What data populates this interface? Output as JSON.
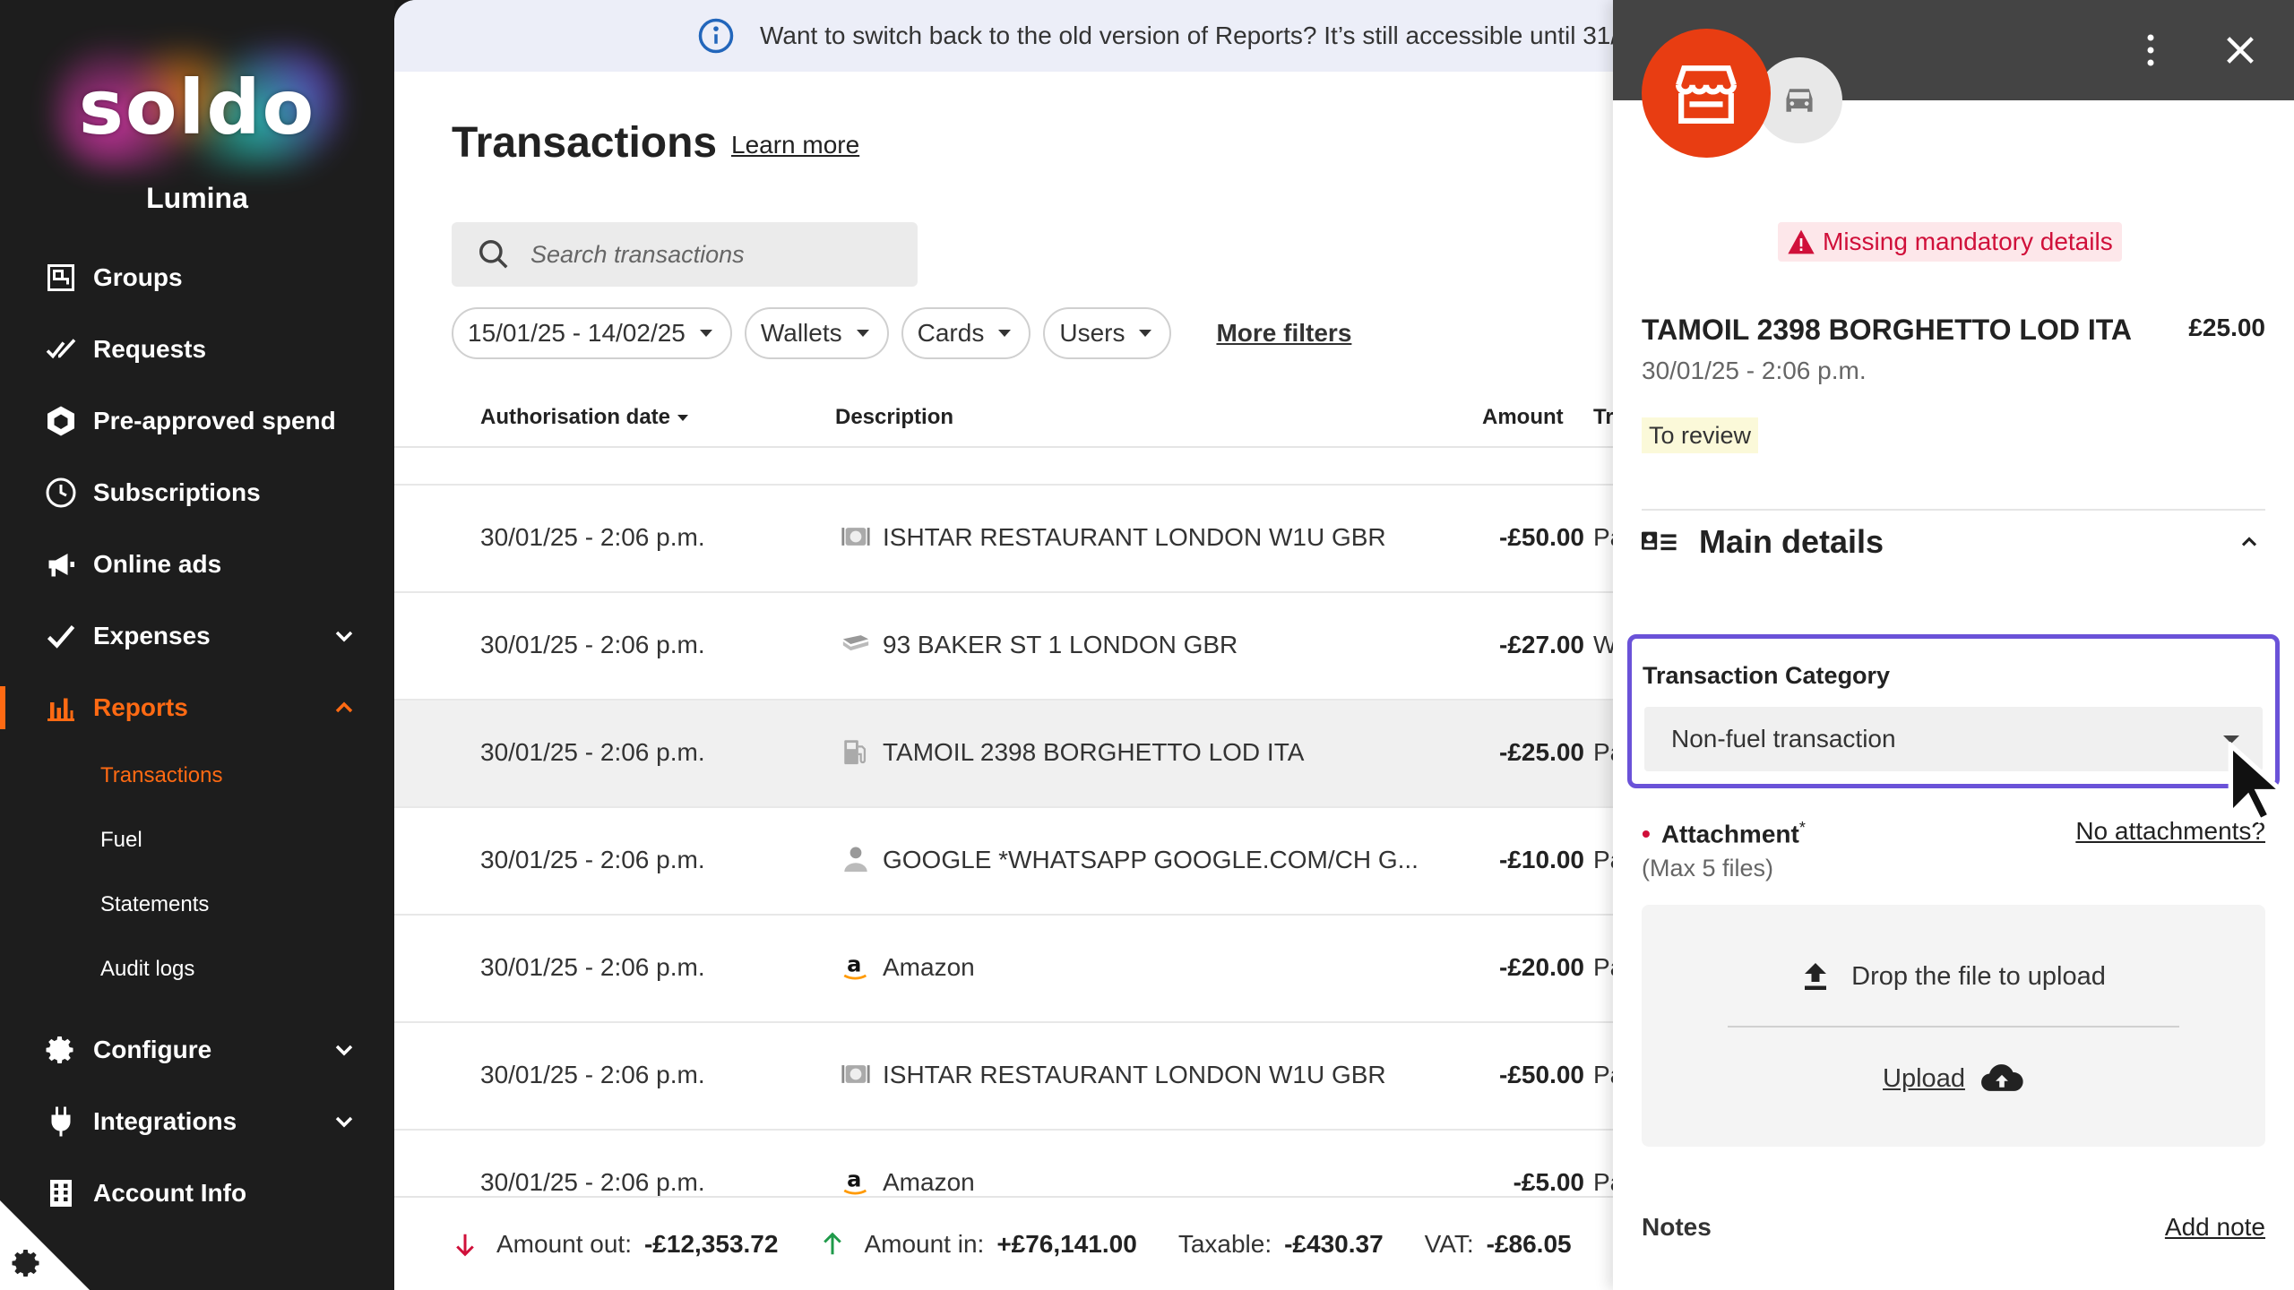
{
  "app": {
    "logo_text": "soldo",
    "org_name": "Lumina"
  },
  "sidebar": {
    "items": [
      {
        "label": "Groups",
        "icon": "groups-icon"
      },
      {
        "label": "Requests",
        "icon": "requests-icon"
      },
      {
        "label": "Pre-approved spend",
        "icon": "pre-approved-icon"
      },
      {
        "label": "Subscriptions",
        "icon": "subscriptions-icon"
      },
      {
        "label": "Online ads",
        "icon": "megaphone-icon"
      },
      {
        "label": "Expenses",
        "icon": "expenses-icon"
      },
      {
        "label": "Reports",
        "icon": "reports-icon"
      },
      {
        "label": "Configure",
        "icon": "gear-icon"
      },
      {
        "label": "Integrations",
        "icon": "plug-icon"
      },
      {
        "label": "Account Info",
        "icon": "building-icon"
      }
    ],
    "reports_sub": [
      "Transactions",
      "Fuel",
      "Statements",
      "Audit logs"
    ],
    "active_item": "Reports",
    "active_sub": "Transactions"
  },
  "banner": {
    "text": "Want to switch back to the old version of Reports? It’s still accessible until 31/"
  },
  "header": {
    "title": "Transactions",
    "learn_more": "Learn more"
  },
  "search": {
    "placeholder": "Search transactions"
  },
  "filters": {
    "date_range": "15/01/25 - 14/02/25",
    "wallets": "Wallets",
    "cards": "Cards",
    "users": "Users",
    "more": "More filters"
  },
  "table": {
    "columns": {
      "date": "Authorisation date",
      "description": "Description",
      "amount": "Amount",
      "type": "Tr"
    },
    "rows": [
      {
        "date": "30/01/25 - 2:06 p.m.",
        "icon": "restaurant-icon",
        "description": "ISHTAR RESTAURANT LONDON W1U GBR",
        "amount": "-£50.00",
        "type": "Pa"
      },
      {
        "date": "30/01/25 - 2:06 p.m.",
        "icon": "cash-icon",
        "description": "93 BAKER ST 1 LONDON GBR",
        "amount": "-£27.00",
        "type": "W"
      },
      {
        "date": "30/01/25 - 2:06 p.m.",
        "icon": "fuel-icon",
        "description": "TAMOIL 2398 BORGHETTO LOD ITA",
        "amount": "-£25.00",
        "type": "Pa"
      },
      {
        "date": "30/01/25 - 2:06 p.m.",
        "icon": "person-icon",
        "description": "GOOGLE *WHATSAPP GOOGLE.COM/CH G...",
        "amount": "-£10.00",
        "type": "Pa"
      },
      {
        "date": "30/01/25 - 2:06 p.m.",
        "icon": "amazon-icon",
        "description": "Amazon",
        "amount": "-£20.00",
        "type": "Pa"
      },
      {
        "date": "30/01/25 - 2:06 p.m.",
        "icon": "restaurant-icon",
        "description": "ISHTAR RESTAURANT LONDON W1U GBR",
        "amount": "-£50.00",
        "type": "Pa"
      },
      {
        "date": "30/01/25 - 2:06 p.m.",
        "icon": "amazon-icon",
        "description": "Amazon",
        "amount": "-£5.00",
        "type": "Pa"
      }
    ]
  },
  "footer": {
    "amount_out_label": "Amount out:",
    "amount_out": "-£12,353.72",
    "amount_in_label": "Amount in:",
    "amount_in": "+£76,141.00",
    "taxable_label": "Taxable:",
    "taxable": "-£430.37",
    "vat_label": "VAT:",
    "vat": "-£86.05"
  },
  "panel": {
    "warning": "Missing mandatory details",
    "merchant": "TAMOIL 2398 BORGHETTO LOD ITA",
    "amount": "£25.00",
    "date": "30/01/25 - 2:06 p.m.",
    "status": "To review",
    "section_title": "Main details",
    "category_label": "Transaction Category",
    "category_value": "Non-fuel transaction",
    "attachment_label": "Attachment",
    "attachment_required_mark": "*",
    "attachment_max": "(Max 5 files)",
    "no_attachments": "No attachments?",
    "drop_text": "Drop the file to upload",
    "upload": "Upload",
    "notes_label": "Notes",
    "add_note": "Add note"
  },
  "colors": {
    "accent": "#ff6a13",
    "focus": "#6a52d8",
    "warning": "#d0103a",
    "merchant_bg": "#e83d12"
  }
}
